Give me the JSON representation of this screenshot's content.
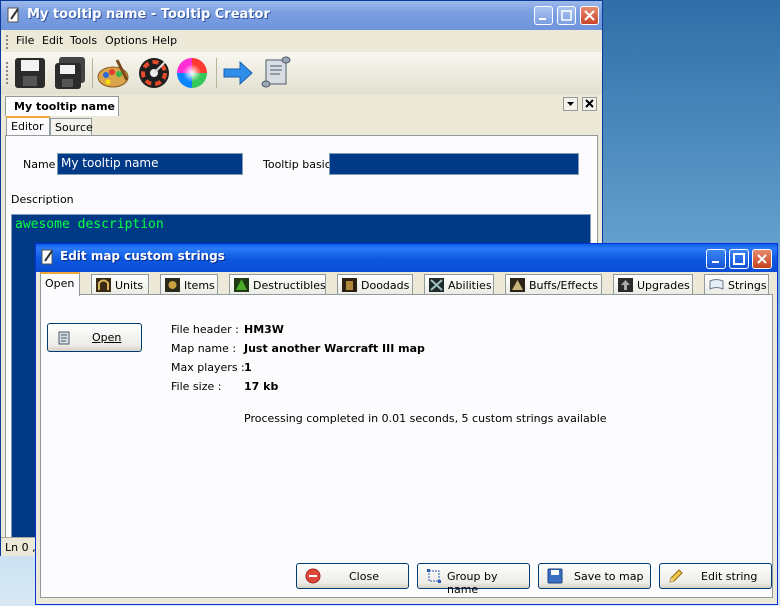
{
  "back_window": {
    "title": "My tooltip name - Tooltip Creator",
    "menu": [
      "File",
      "Edit",
      "Tools",
      "Options",
      "Help"
    ],
    "toolbar_icons": [
      "save-icon",
      "save-all-icon",
      "palette-icon",
      "color-wheel-dark-icon",
      "color-wheel-icon",
      "arrow-right-icon",
      "scroll-icon"
    ],
    "doc_tab": "My tooltip name",
    "sub_tabs": [
      "Editor",
      "Source"
    ],
    "name_label": "Name",
    "name_value": "My tooltip name",
    "tooltip_basic_label": "Tooltip basic",
    "tooltip_basic_value": "",
    "description_label": "Description",
    "description_value": "awesome description",
    "status": "Ln 0 ,"
  },
  "front_window": {
    "title": "Edit map custom strings",
    "tabs": [
      {
        "label": "Open",
        "icon": ""
      },
      {
        "label": "Units",
        "icon": "units-icon"
      },
      {
        "label": "Items",
        "icon": "items-icon"
      },
      {
        "label": "Destructibles",
        "icon": "destructibles-icon"
      },
      {
        "label": "Doodads",
        "icon": "doodads-icon"
      },
      {
        "label": "Abilities",
        "icon": "abilities-icon"
      },
      {
        "label": "Buffs/Effects",
        "icon": "buffs-icon"
      },
      {
        "label": "Upgrades",
        "icon": "upgrades-icon"
      },
      {
        "label": "Strings",
        "icon": "strings-icon"
      }
    ],
    "open_button": "Open",
    "info": {
      "file_header_label": "File header :",
      "file_header_value": "HM3W",
      "map_name_label": "Map name :",
      "map_name_value": "Just another Warcraft III map",
      "max_players_label": "Max players :",
      "max_players_value": "1",
      "file_size_label": "File size :",
      "file_size_value": "17 kb"
    },
    "processing_message": "Processing completed in 0.01 seconds, 5 custom strings available",
    "buttons": {
      "close": "Close",
      "group_by_name": "Group by name",
      "save_to_map": "Save to map",
      "edit_string": "Edit string"
    }
  },
  "colors": {
    "input_bg": "#003a86",
    "description_text": "#00ff40",
    "xp_title_blue": "#0a4dd3"
  }
}
